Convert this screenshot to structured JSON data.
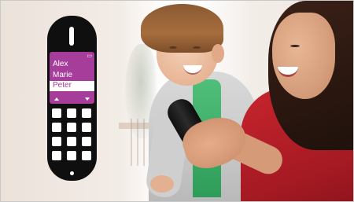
{
  "phone": {
    "screen_color": "#a73d9a",
    "status_icon": "battery-icon",
    "contacts": [
      {
        "name": "Alex"
      },
      {
        "name": "Marie"
      },
      {
        "name": "Peter"
      }
    ],
    "selected_index": 2,
    "keypad": {
      "rows": 4,
      "cols": 3
    }
  },
  "photo": {
    "description_icon": "family-photo",
    "accent_colors": {
      "cardigan": "#cfcfcf",
      "shirt": "#3fb06a",
      "top": "#b81f28"
    }
  }
}
